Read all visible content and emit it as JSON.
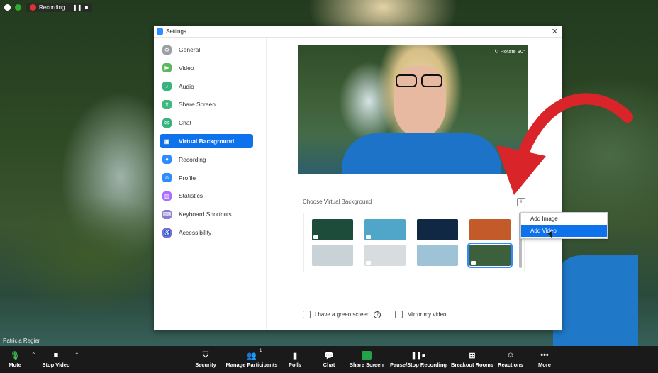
{
  "meeting": {
    "recording_label": "Recording...",
    "participant_name": "Patricia Regier"
  },
  "settings": {
    "title": "Settings",
    "close_glyph": "✕",
    "nav": [
      {
        "label": "General",
        "icon": "gear-icon",
        "color": "#9aa0a6",
        "glyph": "⚙"
      },
      {
        "label": "Video",
        "icon": "video-icon",
        "color": "#5cb85c",
        "glyph": "▶"
      },
      {
        "label": "Audio",
        "icon": "headphones-icon",
        "color": "#36b37e",
        "glyph": "♪"
      },
      {
        "label": "Share Screen",
        "icon": "share-screen-icon",
        "color": "#3fb97f",
        "glyph": "⇧"
      },
      {
        "label": "Chat",
        "icon": "chat-icon",
        "color": "#35b47e",
        "glyph": "✉"
      },
      {
        "label": "Virtual Background",
        "icon": "virtual-background-icon",
        "color": "#ffffff",
        "glyph": "▣"
      },
      {
        "label": "Recording",
        "icon": "recording-icon",
        "color": "#2d8cff",
        "glyph": "●"
      },
      {
        "label": "Profile",
        "icon": "profile-icon",
        "color": "#2d8cff",
        "glyph": "☺"
      },
      {
        "label": "Statistics",
        "icon": "statistics-icon",
        "color": "#a970ff",
        "glyph": "▥"
      },
      {
        "label": "Keyboard Shortcuts",
        "icon": "keyboard-icon",
        "color": "#8a7dd0",
        "glyph": "⌨"
      },
      {
        "label": "Accessibility",
        "icon": "accessibility-icon",
        "color": "#7b6bd6",
        "glyph": "♿"
      }
    ],
    "active_index": 5,
    "preview": {
      "rotate_label": "↻ Rotate 90°"
    },
    "choose_label": "Choose Virtual Background",
    "add_glyph": "+",
    "thumbnails": [
      {
        "name": "aurora",
        "color": "#1d4d3a",
        "video": true
      },
      {
        "name": "beach",
        "color": "#4fa6c9",
        "video": true
      },
      {
        "name": "sunset-city",
        "color": "#102844",
        "video": false
      },
      {
        "name": "golden-gate",
        "color": "#c25a2a",
        "video": false
      },
      {
        "name": "office-1",
        "color": "#c9d2d6",
        "video": false
      },
      {
        "name": "office-2",
        "color": "#d7dcdf",
        "video": true
      },
      {
        "name": "city-skyline",
        "color": "#9fc3d6",
        "video": false
      },
      {
        "name": "waterfall",
        "color": "#3c5f3c",
        "video": true,
        "selected": true
      }
    ],
    "green_screen_label": "I have a green screen",
    "mirror_label": "Mirror my video",
    "help_glyph": "?"
  },
  "menu": {
    "add_image": "Add Image",
    "add_video": "Add Video"
  },
  "toolbar": {
    "mute": "Mute",
    "stop_video": "Stop Video",
    "security": "Security",
    "manage_participants": "Manage Participants",
    "participant_count": "1",
    "polls": "Polls",
    "chat": "Chat",
    "share_screen": "Share Screen",
    "pause_recording": "Pause/Stop Recording",
    "breakout_rooms": "Breakout Rooms",
    "reactions": "Reactions",
    "more": "More"
  },
  "colors": {
    "accent": "#0e72ed",
    "share_green": "#23a347",
    "arrow_red": "#d9242a"
  }
}
